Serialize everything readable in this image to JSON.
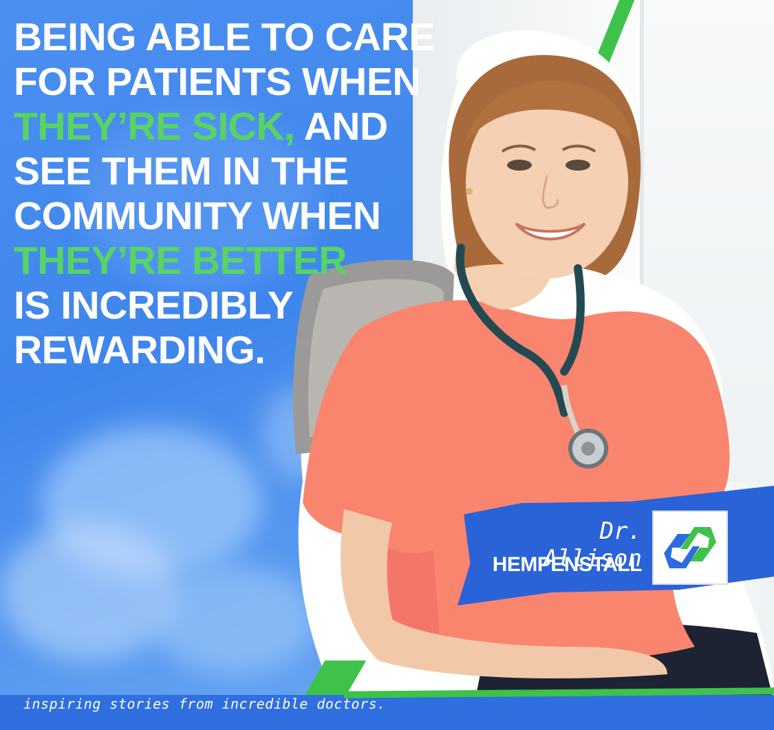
{
  "quote": {
    "line1": "BEING ABLE TO CARE",
    "line2": "FOR PATIENTS WHEN",
    "line3_highlight": "THEY’RE SICK,",
    "line3_rest": " AND",
    "line4": "SEE THEM IN THE",
    "line5": "COMMUNITY WHEN",
    "line6_highlight": "THEY’RE BETTER",
    "line7": "IS INCREDIBLY",
    "line8": "REWARDING."
  },
  "doctor": {
    "first_name": "Dr. Allison",
    "last_name": "HEMPENSTALL"
  },
  "tagline": "inspiring stories from incredible doctors.",
  "colors": {
    "background_blue": "#4b8ff0",
    "highlight_green": "#57d463",
    "stripe_green": "#3ec24a",
    "banner_blue": "#2a62d8",
    "logo_blue": "#2c6be0",
    "logo_green": "#3ec24a"
  },
  "icons": {
    "logo": "infinity-link-logo-icon"
  }
}
